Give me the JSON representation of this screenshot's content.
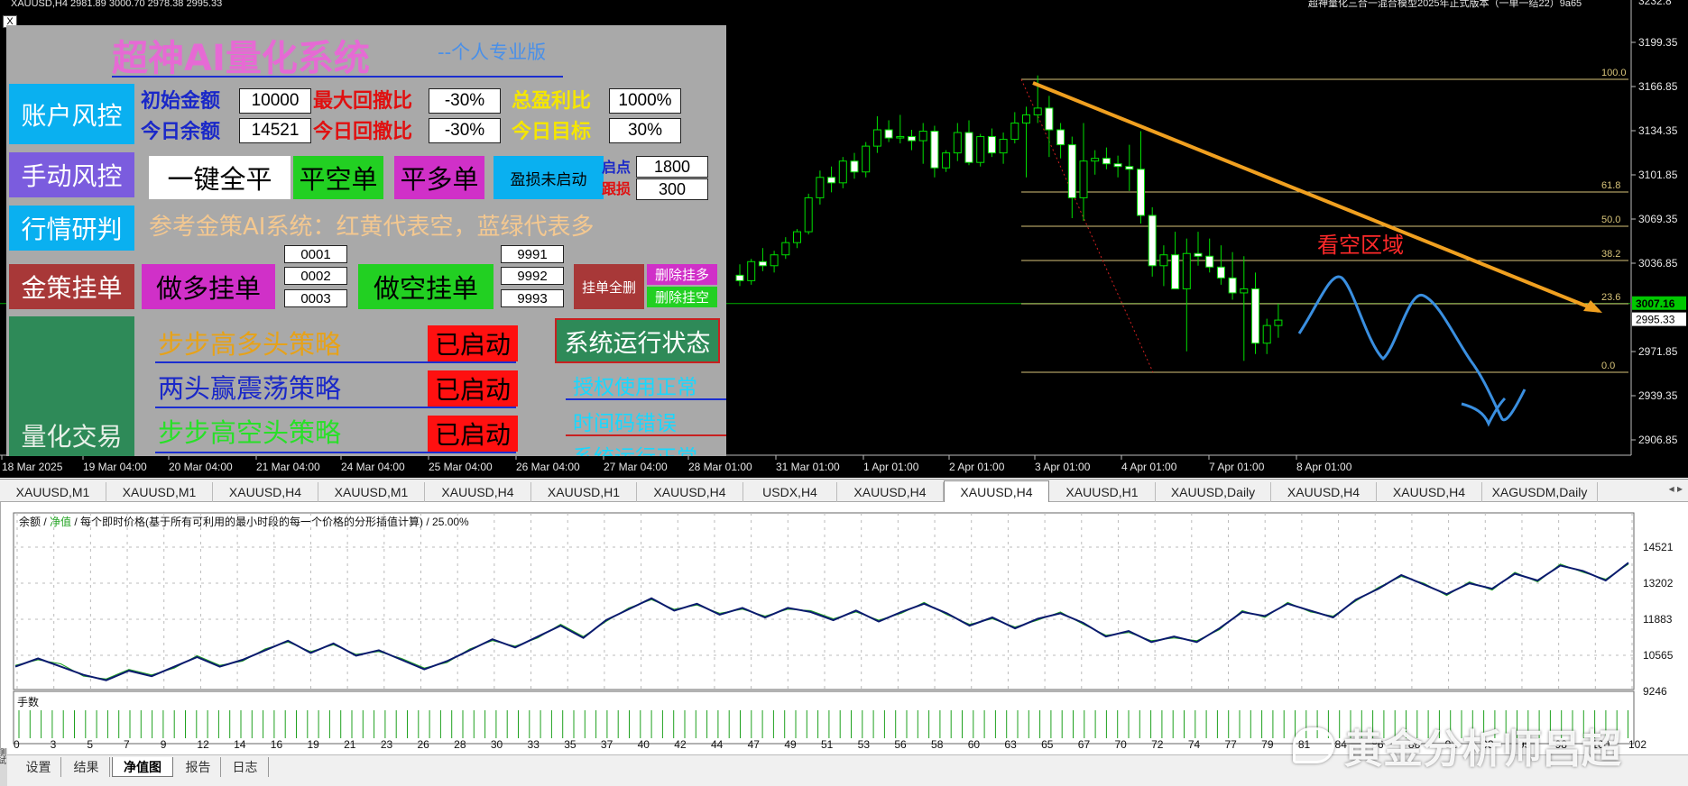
{
  "header": {
    "symbol_info": "XAUUSD,H4  2981.89 3000.70 2978.38 2995.33",
    "ea_title": "超神量化三合一混合模型2025年正式版本（一单一结22）9a65"
  },
  "price_axis": {
    "labels": [
      "3199.35",
      "3166.85",
      "3134.35",
      "3101.85",
      "3069.35",
      "3036.85",
      "2971.85",
      "2939.35",
      "2906.85"
    ],
    "top_label": "3232.8",
    "current_price_green": "3007.16",
    "current_price_white": "2995.33"
  },
  "time_axis": {
    "labels": [
      "18 Mar 2025",
      "19 Mar 04:00",
      "20 Mar 04:00",
      "21 Mar 04:00",
      "24 Mar 04:00",
      "25 Mar 04:00",
      "26 Mar 04:00",
      "27 Mar 04:00",
      "28 Mar 01:00",
      "31 Mar 01:00",
      "1 Apr 01:00",
      "2 Apr 01:00",
      "3 Apr 01:00",
      "4 Apr 01:00",
      "7 Apr 01:00",
      "8 Apr 01:00"
    ]
  },
  "fibonacci": {
    "levels": [
      "100.0",
      "61.8",
      "50.0",
      "38.2",
      "23.6",
      "0.0"
    ]
  },
  "annotation": {
    "bear_zone": "看空区域"
  },
  "candles": [
    [
      3028,
      3036,
      3020,
      3024
    ],
    [
      3024,
      3040,
      3021,
      3038
    ],
    [
      3038,
      3048,
      3031,
      3035
    ],
    [
      3035,
      3046,
      3030,
      3043
    ],
    [
      3043,
      3056,
      3040,
      3052
    ],
    [
      3052,
      3062,
      3048,
      3060
    ],
    [
      3060,
      3088,
      3058,
      3085
    ],
    [
      3085,
      3105,
      3080,
      3100
    ],
    [
      3100,
      3108,
      3089,
      3096
    ],
    [
      3096,
      3115,
      3092,
      3112
    ],
    [
      3112,
      3118,
      3099,
      3104
    ],
    [
      3104,
      3126,
      3100,
      3123
    ],
    [
      3123,
      3145,
      3118,
      3135
    ],
    [
      3135,
      3142,
      3126,
      3129
    ],
    [
      3129,
      3146,
      3125,
      3130
    ],
    [
      3130,
      3135,
      3120,
      3127
    ],
    [
      3127,
      3140,
      3110,
      3134
    ],
    [
      3134,
      3138,
      3100,
      3107
    ],
    [
      3107,
      3120,
      3104,
      3118
    ],
    [
      3118,
      3140,
      3112,
      3133
    ],
    [
      3133,
      3142,
      3109,
      3111
    ],
    [
      3111,
      3132,
      3108,
      3130
    ],
    [
      3130,
      3136,
      3115,
      3118
    ],
    [
      3118,
      3133,
      3110,
      3128
    ],
    [
      3128,
      3148,
      3125,
      3140
    ],
    [
      3140,
      3152,
      3100,
      3146
    ],
    [
      3146,
      3175,
      3140,
      3151
    ],
    [
      3151,
      3160,
      3115,
      3135
    ],
    [
      3135,
      3140,
      3114,
      3124
    ],
    [
      3124,
      3130,
      3070,
      3085
    ],
    [
      3085,
      3140,
      3068,
      3112
    ],
    [
      3112,
      3120,
      3102,
      3114
    ],
    [
      3114,
      3122,
      3106,
      3110
    ],
    [
      3110,
      3116,
      3100,
      3108
    ],
    [
      3108,
      3124,
      3090,
      3106
    ],
    [
      3106,
      3134,
      3066,
      3072
    ],
    [
      3072,
      3078,
      3027,
      3035
    ],
    [
      3035,
      3050,
      3020,
      3043
    ],
    [
      3043,
      3060,
      3020,
      3018
    ],
    [
      3018,
      3055,
      2972,
      3044
    ],
    [
      3044,
      3060,
      3035,
      3042
    ],
    [
      3042,
      3055,
      3030,
      3034
    ],
    [
      3034,
      3050,
      3021,
      3026
    ],
    [
      3026,
      3045,
      3010,
      3015
    ],
    [
      3015,
      3042,
      2965,
      3018
    ],
    [
      3018,
      3030,
      2970,
      2978
    ],
    [
      2978,
      2996,
      2970,
      2991
    ],
    [
      2991,
      3007,
      2982,
      2995
    ]
  ],
  "panel": {
    "title": "超神AI量化系统",
    "subtitle": "--个人专业版",
    "account_risk": "账户风控",
    "init_amount_label": "初始金额",
    "init_amount_value": "10000",
    "max_drawdown_label": "最大回撤比",
    "max_drawdown_value": "-30%",
    "total_profit_label": "总盈利比",
    "total_profit_value": "1000%",
    "today_balance_label": "今日余额",
    "today_balance_value": "14521",
    "today_drawdown_label": "今日回撤比",
    "today_drawdown_value": "-30%",
    "today_target_label": "今日目标",
    "today_target_value": "30%",
    "manual_risk": "手动风控",
    "close_all": "一键全平",
    "close_short": "平空单",
    "close_long": "平多单",
    "sltp_status": "盈损未启动",
    "start_point_label": "启点",
    "start_point_value": "1800",
    "trail_label": "跟损",
    "trail_value": "300",
    "market_research": "行情研判",
    "reference_text": "参考金策AI系统：红黄代表空，蓝绿代表多",
    "gold_orders": "金策挂单",
    "buy_orders": "做多挂单",
    "buy_ids": [
      "0001",
      "0002",
      "0003"
    ],
    "sell_orders": "做空挂单",
    "sell_ids": [
      "9991",
      "9992",
      "9993"
    ],
    "delete_all": "挂单全删",
    "delete_long": "删除挂多",
    "delete_short": "删除挂空",
    "quant_trading": "量化交易",
    "strategy1": "步步高多头策略",
    "strategy2": "两头赢震荡策略",
    "strategy3": "步步高空头策略",
    "started": "已启动",
    "system_status": "系统运行状态",
    "license_ok": "授权使用正常",
    "time_code": "时间码错误",
    "sys_running": "系统运行正常"
  },
  "symbol_tabs": [
    "XAUUSD,M1",
    "XAUUSD,M1",
    "XAUUSD,H4",
    "XAUUSD,M1",
    "XAUUSD,H4",
    "XAUUSD,H1",
    "XAUUSD,H4",
    "USDX,H4",
    "XAUUSD,H4",
    "XAUUSD,H4",
    "XAUUSD,H1",
    "XAUUSD,Daily",
    "XAUUSD,H4",
    "XAUUSD,H4",
    "XAGUSDM,Daily"
  ],
  "active_symbol_tab": 9,
  "equity": {
    "legend_balance": "余额",
    "legend_equity": "净值",
    "legend_rest": "/ 每个即时价格(基于所有可利用的最小时段的每一个价格的分形插值计算) / 25.00%",
    "y_labels": [
      "14521",
      "13202",
      "11883",
      "10565",
      "9246"
    ],
    "lots_label": "手数",
    "x_labels": [
      "0",
      "3",
      "5",
      "7",
      "9",
      "12",
      "14",
      "16",
      "19",
      "21",
      "23",
      "26",
      "28",
      "30",
      "33",
      "35",
      "37",
      "40",
      "42",
      "44",
      "47",
      "49",
      "51",
      "53",
      "56",
      "58",
      "60",
      "63",
      "65",
      "67",
      "70",
      "72",
      "74",
      "77",
      "79",
      "81",
      "84",
      "86",
      "88",
      "91",
      "93",
      "95",
      "98",
      "100",
      "102"
    ]
  },
  "chart_data": {
    "type": "line",
    "ylim": [
      9246,
      14521
    ],
    "series": [
      {
        "name": "余额",
        "values": [
          10150,
          10450,
          10150,
          9850,
          9650,
          10000,
          9800,
          10150,
          10500,
          10150,
          10400,
          10750,
          11100,
          10650,
          11000,
          10550,
          10750,
          10400,
          10050,
          10350,
          10750,
          11150,
          10850,
          11250,
          11650,
          11200,
          11850,
          12250,
          12650,
          12200,
          12450,
          12050,
          12300,
          11950,
          12300,
          12150,
          11850,
          12200,
          11800,
          12150,
          12450,
          12100,
          11650,
          11950,
          11550,
          11900,
          12100,
          11750,
          11250,
          11450,
          11050,
          11250,
          11050,
          11550,
          12150,
          12000,
          12450,
          12200,
          11950,
          12600,
          13000,
          13500,
          13150,
          12800,
          13200,
          13000,
          13550,
          13300,
          13850,
          13650,
          13300,
          13950
        ]
      },
      {
        "name": "净值",
        "values": [
          10200,
          10400,
          10250,
          9800,
          9700,
          10050,
          9850,
          10100,
          10550,
          10200,
          10350,
          10800,
          11050,
          10700,
          10950,
          10600,
          10700,
          10450,
          10100,
          10300,
          10800,
          11100,
          10900,
          11200,
          11700,
          11250,
          11800,
          12300,
          12600,
          12250,
          12400,
          12100,
          12250,
          12000,
          12250,
          12200,
          11900,
          12150,
          11850,
          12100,
          12500,
          12050,
          11700,
          11900,
          11600,
          11850,
          12150,
          11700,
          11300,
          11400,
          11100,
          11200,
          11100,
          11500,
          12200,
          11950,
          12500,
          12150,
          12000,
          12550,
          13050,
          13450,
          13200,
          12750,
          13250,
          12950,
          13600,
          13250,
          13900,
          13600,
          13350,
          13900
        ]
      }
    ]
  },
  "bottom_tabs": [
    "设置",
    "结果",
    "净值图",
    "报告",
    "日志"
  ],
  "active_bottom_tab": 2,
  "side_label": "测试",
  "watermark": "黄金分析师吕超",
  "colors": {
    "chart_bg": "#000000",
    "candle_outline": "#00e000",
    "fib": "#d8c47a",
    "trendline": "#f0a020",
    "projection": "#3a8fe0",
    "bear_text": "#ff2a2a",
    "balance_line": "#0a1a6e",
    "equity_line": "#1fa11f"
  }
}
